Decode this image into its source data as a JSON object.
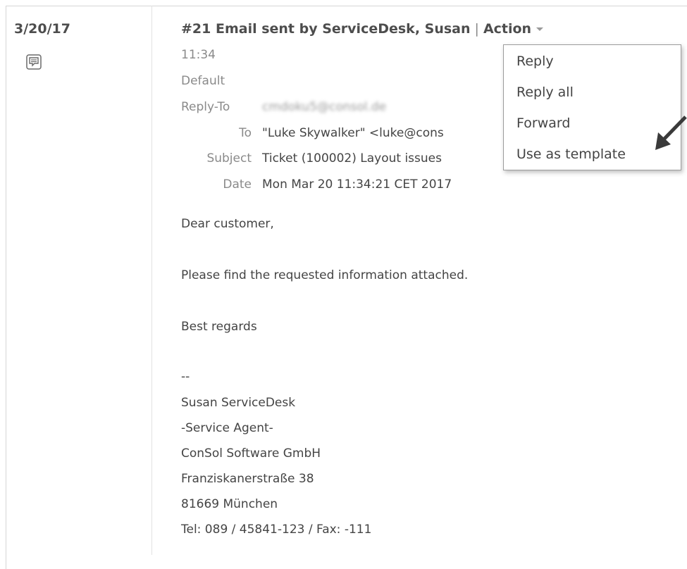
{
  "entry": {
    "date": "3/20/17",
    "note_icon": "comment-icon"
  },
  "email": {
    "title": "#21 Email sent by ServiceDesk, Susan",
    "separator": "|",
    "action_label": "Action",
    "time": "11:34",
    "template": "Default",
    "fields": {
      "reply_to_label": "Reply-To",
      "reply_to_value": "cmdoku5@consol.de",
      "to_label": "To",
      "to_value": "\"Luke Skywalker\" <luke@cons",
      "subject_label": "Subject",
      "subject_value": "Ticket (100002) Layout issues",
      "date_label": "Date",
      "date_value": "Mon Mar 20 11:34:21 CET 2017"
    },
    "body": {
      "greeting": "Dear customer,",
      "line1": "Please find the requested information attached.",
      "closing": "Best regards",
      "sig_sep": "--",
      "sig_name": "Susan ServiceDesk",
      "sig_role": "-Service Agent-",
      "sig_company": "ConSol Software GmbH",
      "sig_street": "Franziskanerstraße 38",
      "sig_city": "81669 München",
      "sig_phone": "Tel: 089 / 45841-123 / Fax: -111"
    }
  },
  "action_menu": {
    "items": [
      "Reply",
      "Reply all",
      "Forward",
      "Use as template"
    ]
  },
  "colors": {
    "menu_border": "#9c9c9c",
    "label_gray": "#8a8a8a",
    "arrow": "#3a3a3a"
  }
}
